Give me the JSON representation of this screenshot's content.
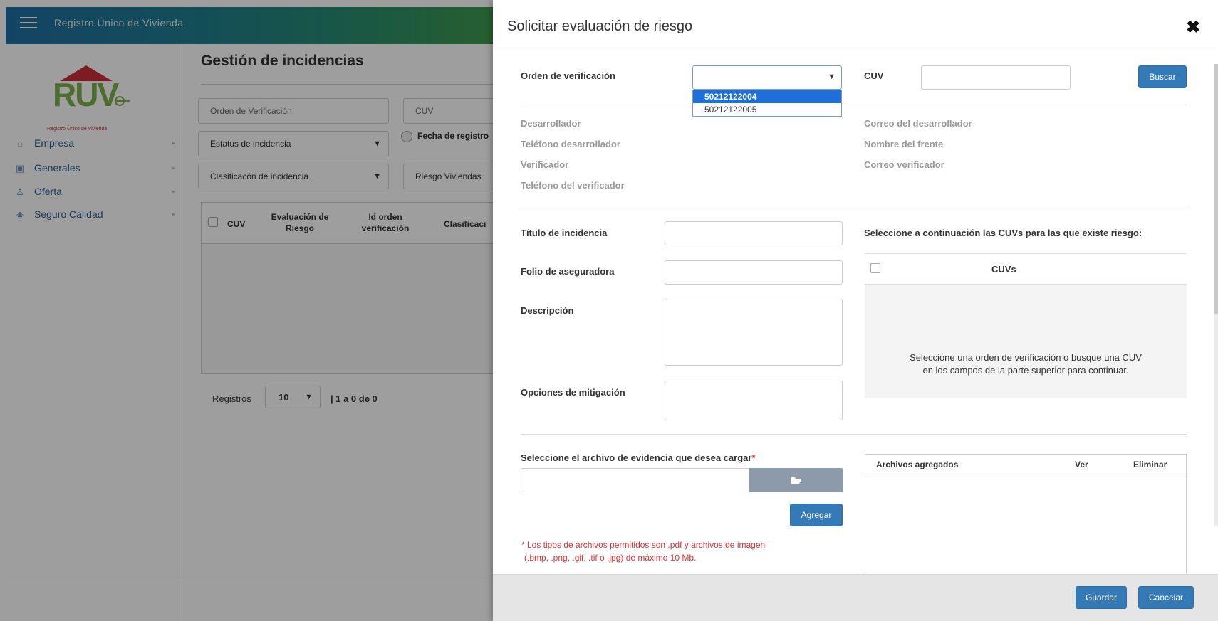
{
  "app": {
    "title": "Registro Único de Vivienda",
    "logo_text": "RUV",
    "logo_sub": "Registro Único de Vivienda"
  },
  "sidebar": {
    "items": [
      {
        "label": "Empresa",
        "icon": "building-icon"
      },
      {
        "label": "Generales",
        "icon": "id-card-icon"
      },
      {
        "label": "Oferta",
        "icon": "user-icon"
      },
      {
        "label": "Seguro Calidad",
        "icon": "shield-icon"
      }
    ]
  },
  "main": {
    "title": "Gestión de incidencias",
    "filters": {
      "orden_placeholder": "Orden de Verificación",
      "cuv_placeholder": "CUV",
      "estatus": "Estatus de incidencia",
      "fecha": "Fecha de registro",
      "clasificacion": "Clasificacón de incidencia",
      "riesgo": "Riesgo Viviendas"
    },
    "table_headers": [
      "CUV",
      "Evaluación de Riesgo",
      "Id orden verificación",
      "Clasificaci"
    ],
    "registros_label": "Registros",
    "page_size": "10",
    "count": "| 1 a 0 de 0"
  },
  "modal": {
    "title": "Solicitar evaluación de riesgo",
    "close": "✖",
    "orden_label": "Orden de verificación",
    "orden_options": [
      "50212122004",
      "50212122005"
    ],
    "orden_selected_index": 0,
    "cuv_label": "CUV",
    "buscar": "Buscar",
    "info_left": [
      "Desarrollador",
      "Teléfono desarrollador",
      "Verificador",
      "Teléfono del verificador"
    ],
    "info_right": [
      "Correo del desarrollador",
      "Nombre del frente",
      "Correo verificador"
    ],
    "titulo_label": "Título de incidencia",
    "folio_label": "Folio de aseguradora",
    "descripcion_label": "Descripción",
    "mitigacion_label": "Opciones de mitigación",
    "cuvs_prompt": "Seleccione a continuación las CUVs para las que existe riesgo:",
    "cuvs_header": "CUVs",
    "cuvs_empty_1": "Seleccione una orden de verificación o busque una CUV",
    "cuvs_empty_2": "en los campos de la parte superior para continuar.",
    "archivo_label": "Seleccione el archivo de evidencia que desea cargar",
    "required_mark": "*",
    "agregar": "Agregar",
    "note_1": "* Los tipos de archivos permitidos son .pdf y archivos de imagen",
    "note_2": "(.bmp, .png, .gif, .tif o .jpg) de máximo 10 Mb.",
    "files_headers": {
      "name": "Archivos agregados",
      "ver": "Ver",
      "eliminar": "Eliminar"
    },
    "guardar": "Guardar",
    "cancelar": "Cancelar"
  },
  "colors": {
    "primary_button": "#337ab7",
    "dropdown_highlight": "#1e6fd9",
    "note_red": "#e53030",
    "logo_green": "#7bb04a",
    "logo_roof": "#c8303a"
  }
}
